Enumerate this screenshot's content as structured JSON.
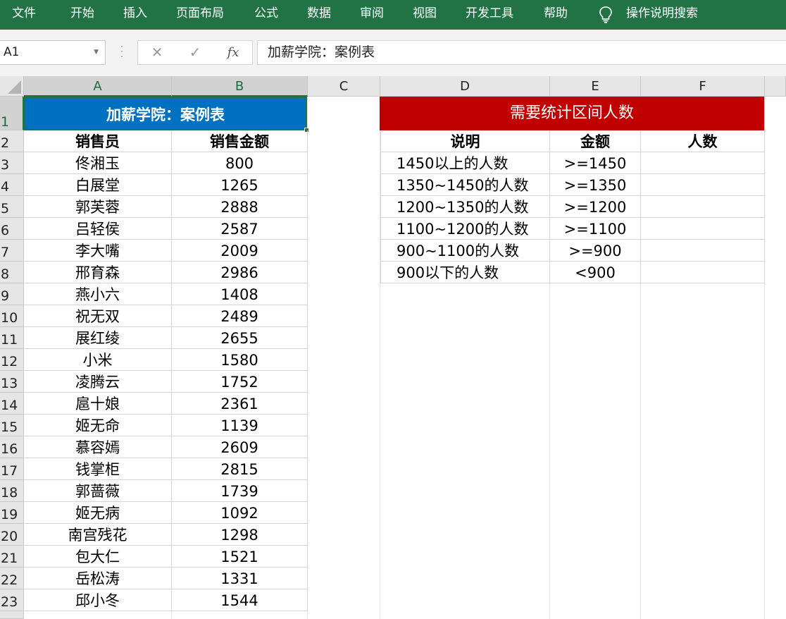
{
  "ribbon": {
    "tabs": [
      "文件",
      "开始",
      "插入",
      "页面布局",
      "公式",
      "数据",
      "审阅",
      "视图",
      "开发工具",
      "帮助"
    ],
    "tell_me": "操作说明搜索",
    "bg_color": "#217346"
  },
  "formula_bar": {
    "name_box": "A1",
    "cancel_symbol": "✕",
    "enter_symbol": "✓",
    "fx_symbol": "fx",
    "content": "加薪学院：案例表"
  },
  "columns": [
    "A",
    "B",
    "C",
    "D",
    "E",
    "F"
  ],
  "rows": [
    "1",
    "2",
    "3",
    "4",
    "5",
    "6",
    "7",
    "8",
    "9",
    "10",
    "11",
    "12",
    "13",
    "14",
    "15",
    "16",
    "17",
    "18",
    "19",
    "20",
    "21",
    "22",
    "23"
  ],
  "left_table": {
    "title": "加薪学院：案例表",
    "headers": [
      "销售员",
      "销售金额"
    ],
    "rows": [
      [
        "佟湘玉",
        "800"
      ],
      [
        "白展堂",
        "1265"
      ],
      [
        "郭芙蓉",
        "2888"
      ],
      [
        "吕轻侯",
        "2587"
      ],
      [
        "李大嘴",
        "2009"
      ],
      [
        "邢育森",
        "2986"
      ],
      [
        "燕小六",
        "1408"
      ],
      [
        "祝无双",
        "2489"
      ],
      [
        "展红绫",
        "2655"
      ],
      [
        "小米",
        "1580"
      ],
      [
        "凌腾云",
        "1752"
      ],
      [
        "扈十娘",
        "2361"
      ],
      [
        "姬无命",
        "1139"
      ],
      [
        "慕容嫣",
        "2609"
      ],
      [
        "钱掌柜",
        "2815"
      ],
      [
        "郭蔷薇",
        "1739"
      ],
      [
        "姬无病",
        "1092"
      ],
      [
        "南宫残花",
        "1298"
      ],
      [
        "包大仁",
        "1521"
      ],
      [
        "岳松涛",
        "1331"
      ],
      [
        "邱小冬",
        "1544"
      ]
    ],
    "title_color": "#0070c0"
  },
  "right_table": {
    "title": "需要统计区间人数",
    "headers": [
      "说明",
      "金额",
      "人数"
    ],
    "rows": [
      [
        "1450以上的人数",
        ">=1450",
        ""
      ],
      [
        "1350~1450的人数",
        ">=1350",
        ""
      ],
      [
        "1200~1350的人数",
        ">=1200",
        ""
      ],
      [
        "1100~1200的人数",
        ">=1100",
        ""
      ],
      [
        "900~1100的人数",
        ">=900",
        ""
      ],
      [
        "900以下的人数",
        "<900",
        ""
      ]
    ],
    "title_color": "#c00000"
  }
}
